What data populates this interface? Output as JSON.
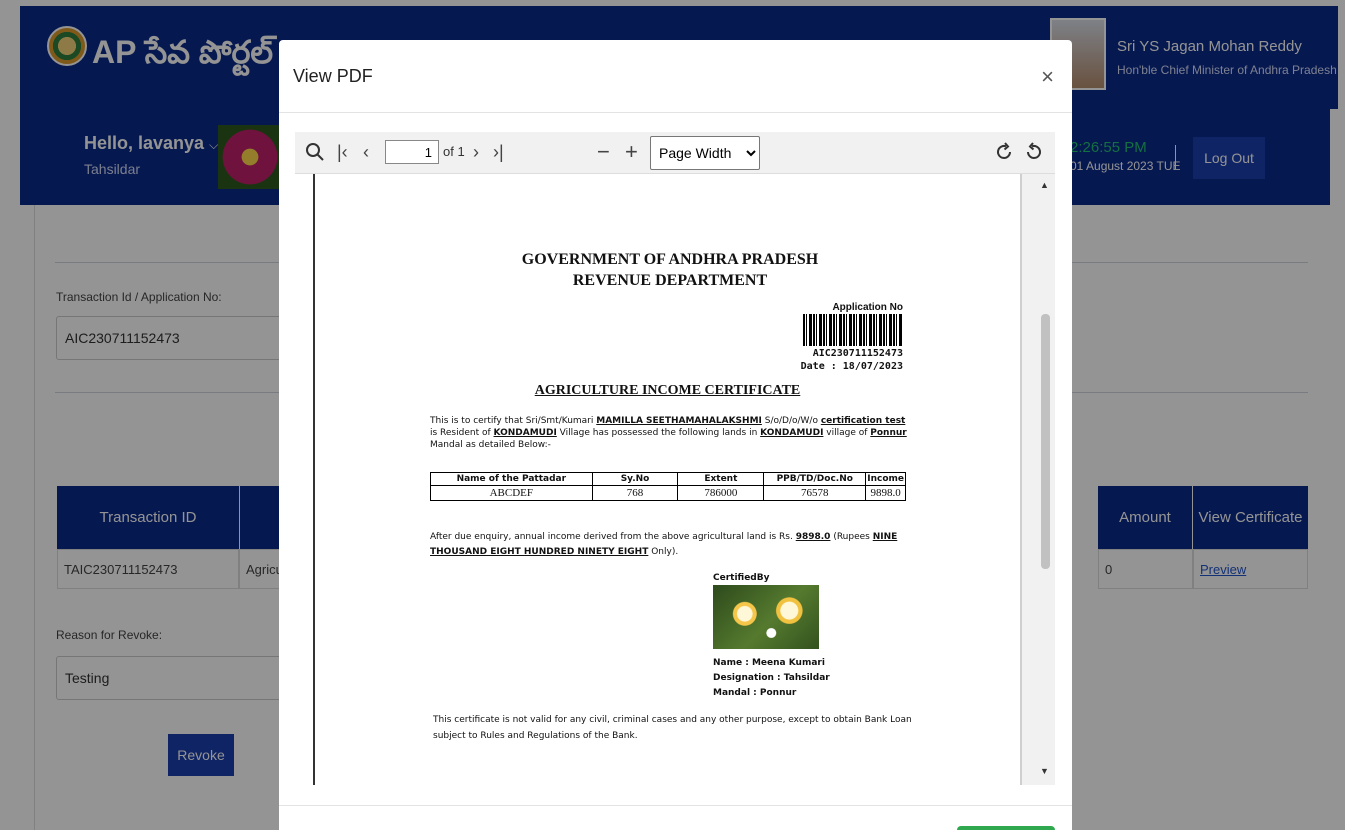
{
  "header": {
    "portal_name": "AP సేవ పోర్టల్",
    "cm_name": "Sri YS Jagan Mohan Reddy",
    "cm_title": "Hon'ble Chief Minister of Andhra Pradesh"
  },
  "user": {
    "greeting": "Hello, lavanya",
    "role": "Tahsildar",
    "clock": "2:26:55 PM",
    "date": "01 August 2023 TUE",
    "logout_label": "Log Out"
  },
  "form": {
    "txn_label": "Transaction Id / Application No:",
    "txn_value": "AIC230711152473",
    "reason_label": "Reason for Revoke:",
    "reason_value": "Testing",
    "revoke_label": "Revoke"
  },
  "table": {
    "headers": [
      "Transaction ID",
      "",
      "Amount",
      "View Certificate"
    ],
    "row": [
      "TAIC230711152473",
      "Agricu",
      "0",
      "Preview"
    ]
  },
  "modal": {
    "title": "View PDF",
    "close": "×"
  },
  "viewer": {
    "page": "1",
    "page_of": "of 1",
    "zoom": "Page Width",
    "zoom_options": [
      "Page Width"
    ]
  },
  "certificate": {
    "gov": "GOVERNMENT OF ANDHRA PRADESH",
    "dept": "REVENUE DEPARTMENT",
    "app_label": "Application No",
    "app_no": "AIC230711152473",
    "app_date": "Date : 18/07/2023",
    "heading": "AGRICULTURE INCOME CERTIFICATE",
    "body_1": "This is to certify that Sri/Smt/Kumari ",
    "name": "MAMILLA SEETHAMAHALAKSHMI",
    "body_2": " S/o/D/o/W/o ",
    "relation": "certification test",
    "body_3": " is Resident of ",
    "village": "KONDAMUDI",
    "body_4": " Village has possessed the following lands in ",
    "village2": "KONDAMUDI",
    "body_5": " village of ",
    "mandal": "Ponnur",
    "body_6": " Mandal as detailed Below:-",
    "table_headers": [
      "Name of the Pattadar",
      "Sy.No",
      "Extent",
      "PPB/TD/Doc.No",
      "Income"
    ],
    "table_row": [
      "ABCDEF",
      "768",
      "786000",
      "76578",
      "9898.0"
    ],
    "income_1": "After due enquiry, annual income derived from the above agricultural land is Rs. ",
    "income_value": "9898.0",
    "income_2": " (Rupees ",
    "income_words": "NINE THOUSAND EIGHT HUNDRED NINETY EIGHT",
    "income_3": " Only).",
    "certified_by": "CertifiedBy",
    "sign_name": "Name : Meena Kumari",
    "sign_designation": "Designation : Tahsildar",
    "sign_mandal": "Mandal : Ponnur",
    "footer": "This certificate is not valid for any civil, criminal cases and any other purpose, except to obtain Bank Loan subject to Rules and Regulations of the Bank."
  }
}
